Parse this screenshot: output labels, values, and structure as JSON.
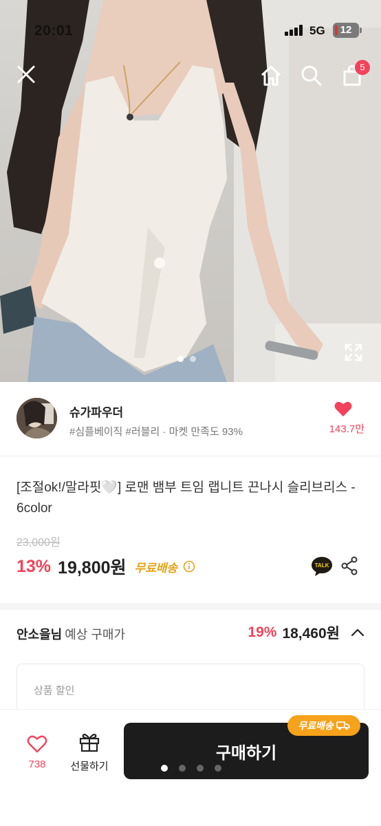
{
  "status_bar": {
    "time": "20:01",
    "network": "5G",
    "battery": "12"
  },
  "hero": {
    "cart_count": "5",
    "image_pages": 2,
    "active_page": 1
  },
  "seller": {
    "name": "슈가파우더",
    "tags": "#심플베이직 #러블리 · 마켓 만족도 93%",
    "like_count": "143.7만"
  },
  "product": {
    "title": "[조절ok!/말라핏🤍] 로맨 뱀부 트임 랩니트 끈나시 슬리브리스 - 6color",
    "original_price": "23,000원",
    "discount": "13%",
    "price": "19,800원",
    "free_shipping": "무료배송",
    "talk_label": "TALK"
  },
  "expected": {
    "user_name": "안소을님",
    "label": "예상 구매가",
    "discount": "19%",
    "price": "18,460원"
  },
  "card": {
    "label": "상품 할인"
  },
  "bottom_bar": {
    "wish_count": "738",
    "gift_label": "선물하기",
    "buy_label": "구매하기",
    "ship_badge": "무료배송",
    "pager_dots": 4,
    "active_dot": 1
  },
  "colors": {
    "accent": "#f2425b",
    "free_ship": "#e4a116",
    "badge": "#f7a21b",
    "buy_button": "#1c1c1c"
  }
}
